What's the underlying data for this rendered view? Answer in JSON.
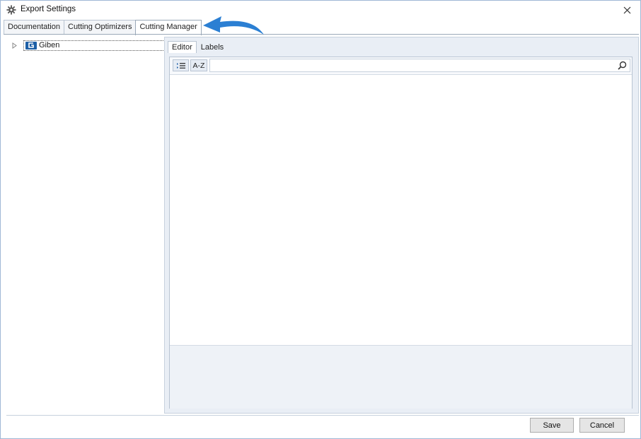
{
  "window": {
    "title": "Export Settings",
    "title_icon": "gear-icon",
    "close_label": "×"
  },
  "tabs": [
    {
      "label": "Documentation",
      "active": false
    },
    {
      "label": "Cutting Optimizers",
      "active": false
    },
    {
      "label": "Cutting Manager",
      "active": true
    }
  ],
  "tree": {
    "items": [
      {
        "label": "Giben",
        "icon": "giben-logo",
        "expander": "▷"
      }
    ]
  },
  "subtabs": [
    {
      "label": "Editor",
      "active": true
    },
    {
      "label": "Labels",
      "active": false
    }
  ],
  "toolbar": {
    "categorized_icon": "categorized-list-icon",
    "sort_label": "A-Z",
    "search_value": "",
    "search_icon": "search-icon"
  },
  "footer": {
    "save_label": "Save",
    "cancel_label": "Cancel"
  },
  "colors": {
    "accent_arrow": "#2b7fd3",
    "panel_bg": "#e9eef5",
    "border": "#b9c4d2"
  }
}
